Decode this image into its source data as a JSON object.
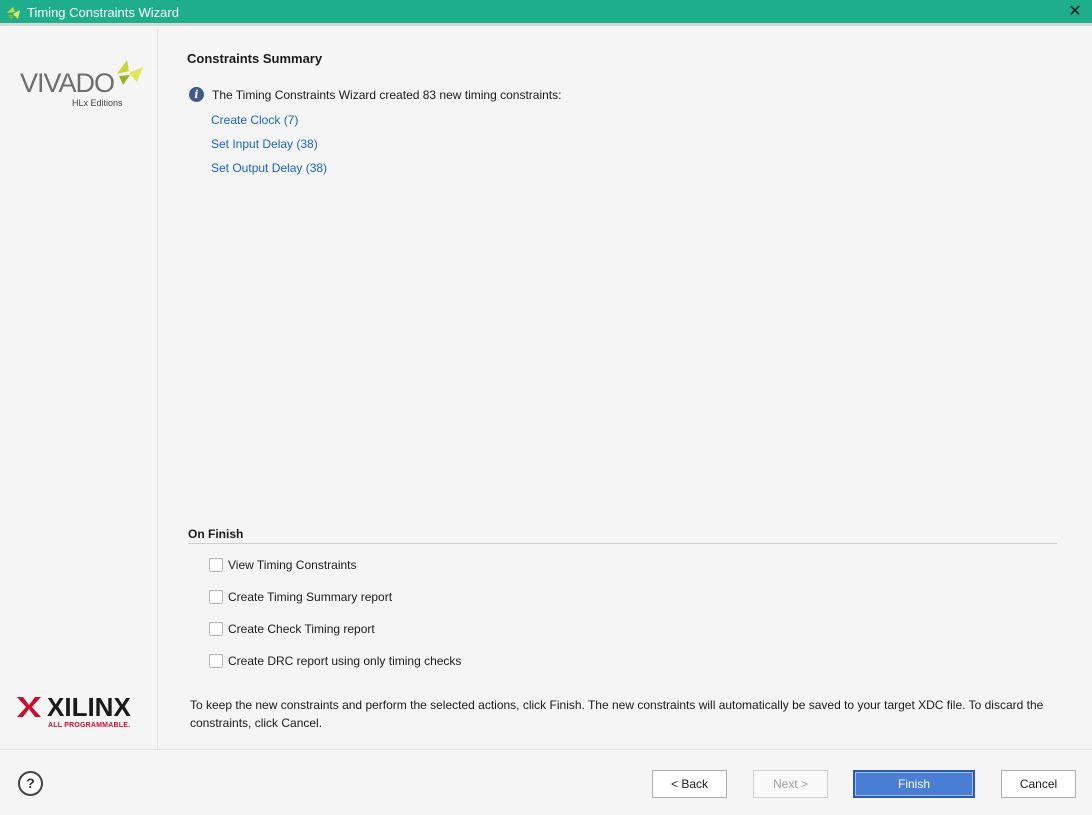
{
  "window": {
    "title": "Timing Constraints Wizard",
    "close_glyph": "✕"
  },
  "sidebar": {
    "vivado_logo": {
      "text": "VIVADO",
      "sub": "HLx Editions"
    },
    "xilinx_logo": {
      "text": "XILINX",
      "sub": "ALL PROGRAMMABLE."
    }
  },
  "summary": {
    "title": "Constraints Summary",
    "info_text": "The Timing Constraints Wizard created 83 new timing constraints:",
    "links": [
      {
        "label": "Create Clock (7)"
      },
      {
        "label": "Set Input Delay (38)"
      },
      {
        "label": "Set Output Delay (38)"
      }
    ]
  },
  "on_finish": {
    "title": "On Finish",
    "options": [
      {
        "label": "View Timing Constraints",
        "checked": false
      },
      {
        "label": "Create Timing Summary report",
        "checked": false
      },
      {
        "label": "Create Check Timing report",
        "checked": false
      },
      {
        "label": "Create DRC report using only timing checks",
        "checked": false
      }
    ]
  },
  "footnote": "To keep the new constraints and perform the selected actions, click Finish. The new constraints will automatically be saved to your target XDC file. To discard the constraints, click Cancel.",
  "buttons": {
    "help": "?",
    "back": "< Back",
    "next": "Next >",
    "finish": "Finish",
    "cancel": "Cancel"
  },
  "colors": {
    "titlebar": "#1fae8c",
    "link": "#1a61c7",
    "primary_button": "#4a7dd4",
    "xilinx_red": "#c8102e",
    "vivado_leaf": "#a8c43a"
  }
}
